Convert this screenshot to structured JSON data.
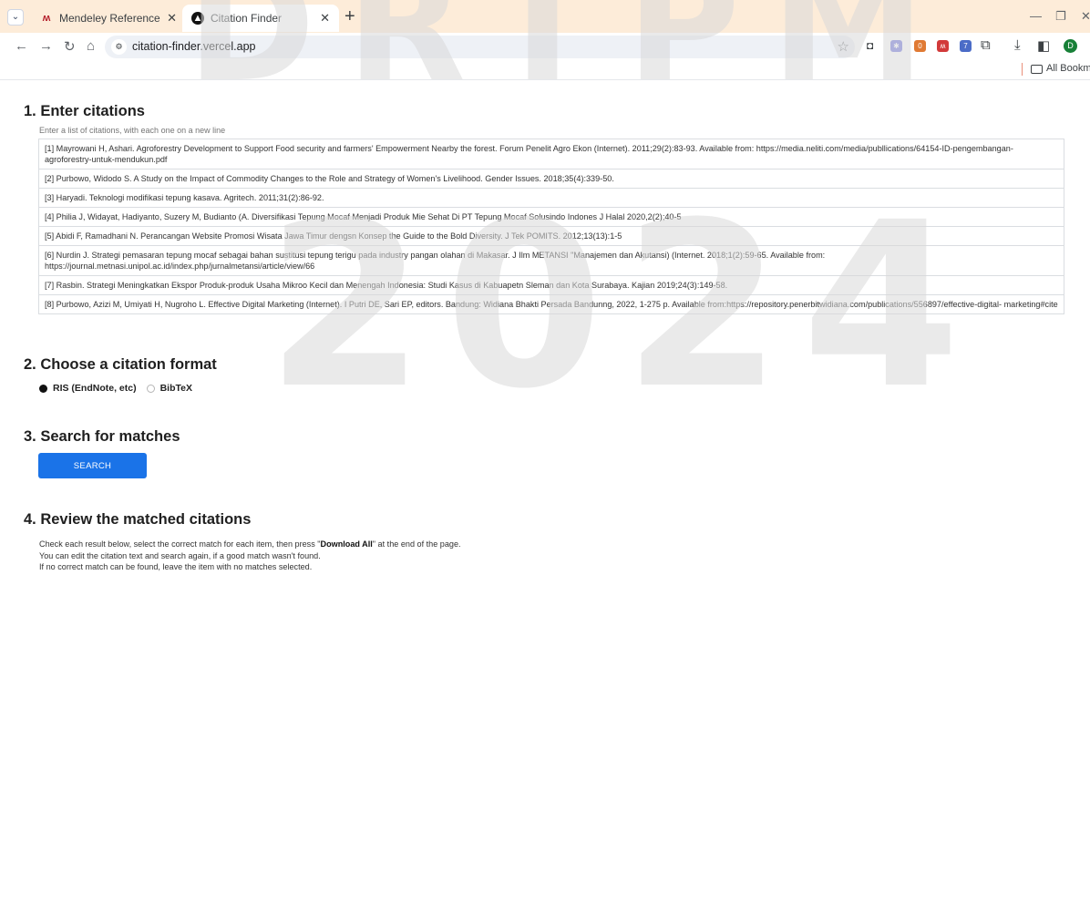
{
  "browser": {
    "tabs": [
      {
        "title": "Mendeley Reference Manager",
        "favicon": "mendeley-icon"
      },
      {
        "title": "Citation Finder",
        "favicon": "citation-finder-icon",
        "active": true
      }
    ],
    "new_tab": "+",
    "url": "citation-finder.vercel.app",
    "bookmarks_label": "All Bookmarks",
    "profile_initial": "D",
    "extension_badge_1": "0",
    "extension_badge_2": "7",
    "accent": "#1a73e8",
    "tabbar_color": "#fdecd9"
  },
  "watermark": {
    "top": "DRTPM",
    "mid": "2024"
  },
  "section1": {
    "title": "1. Enter citations",
    "hint": "Enter a list of citations, with each one on a new line",
    "citations": [
      "[1]   Mayrowani H, Ashari. Agroforestry Development to Support Food security and farmers' Empowerment Nearby the forest. Forum Penelit Agro Ekon (Internet). 2011;29(2):83-93. Available from: https://media.neliti.com/media/publlications/64154-ID-pengembangan- agroforestry-untuk-mendukun.pdf",
      "[2]   Purbowo, Widodo S. A Study on the Impact of Commodity Changes to the Role and Strategy of Women's Livelihood. Gender Issues. 2018;35(4):339-50.",
      "[3]   Haryadi. Teknologi modifikasi tepung kasava. Agritech. 2011;31(2):86-92.",
      "[4]   Philia J, Widayat, Hadiyanto, Suzery M, Budianto (A. Diversifikasi Tepung Mocaf Menjadi Produk Mie Sehat Di PT Tepung Mocaf Solusindo Indones J Halal 2020,2(2);40-5",
      "[5]   Abidi F, Ramadhani N. Perancangan Website Promosi Wisata Jawa Timur dengsn Konsep the Guide to the Bold Diversity. J Tek POMITS. 2012;13(13):1-5",
      "[6]   Nurdin J. Strategi pemasaran tepung mocaf sebagai bahan sustitusi tepung terigu pada industry pangan olahan di Makasar. J Ilm METANSI \"Manajemen dan Akutansi) (Internet. 2018;1(2):59-65.  Available  from: https://journal.metnasi.unipol.ac.id/index.php/jurnalmetansi/article/view/66",
      "[7]   Rasbin. Strategi Meningkatkan Ekspor Produk-produk Usaha Mikroo Kecil dan Menengah Indonesia: Studi Kasus di Kabuapetn Sleman dan Kota Surabaya. Kajian 2019;24(3):149-58.",
      "[8]   Purbowo, Azizi M, Umiyati H, Nugroho L. Effective Digital Marketing (Internet). I Putri DE, Sari EP, editors. Bandung: Widiana Bhakti Persada Bandunng, 2022, 1-275 p. Available from:https://repository.penerbitwidiana.com/publications/556897/effective-digital- marketing#cite"
    ]
  },
  "section2": {
    "title": "2. Choose a citation format",
    "options": [
      {
        "label": "RIS (EndNote, etc)",
        "selected": true
      },
      {
        "label": "BibTeX",
        "selected": false
      }
    ]
  },
  "section3": {
    "title": "3. Search for matches",
    "button_label": "SEARCH"
  },
  "section4": {
    "title": "4. Review the matched citations",
    "line1_before": "Check each result below, select the correct match for each item, then press \"",
    "line1_bold": "Download All",
    "line1_after": "\" at the end of the page.",
    "line2": "You can edit the citation text and search again, if a good match wasn't found.",
    "line3": "If no correct match can be found, leave the item with no matches selected."
  }
}
